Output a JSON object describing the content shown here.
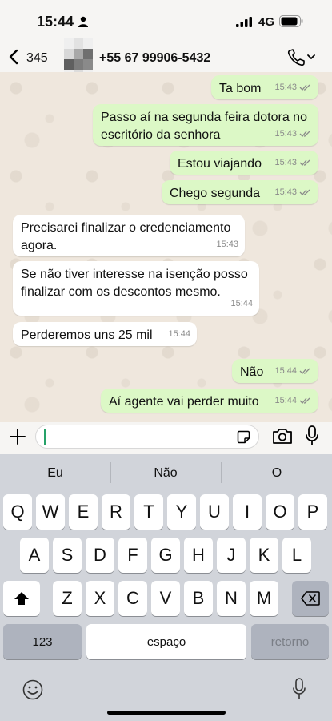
{
  "status_bar": {
    "time": "15:44",
    "network": "4G"
  },
  "header": {
    "back_count": "345",
    "contact": "+55 67 99906-5432"
  },
  "messages": [
    {
      "dir": "out",
      "text": "Ta bom",
      "time": "15:43"
    },
    {
      "dir": "out",
      "text": "Passo aí na segunda feira dotora no\nescritório da senhora",
      "time": "15:43"
    },
    {
      "dir": "out",
      "text": "Estou viajando",
      "time": "15:43"
    },
    {
      "dir": "out",
      "text": "Chego segunda",
      "time": "15:43"
    },
    {
      "dir": "in",
      "text": "Precisarei finalizar o credenciamento\nagora.",
      "time": "15:43"
    },
    {
      "dir": "in",
      "text": "Se não tiver interesse na isenção posso\nfinalizar com os descontos mesmo.",
      "time": "15:44"
    },
    {
      "dir": "in",
      "text": "Perderemos uns 25 mil",
      "time": "15:44"
    },
    {
      "dir": "out",
      "text": "Não",
      "time": "15:44"
    },
    {
      "dir": "out",
      "text": "Aí agente vai perder muito",
      "time": "15:44"
    }
  ],
  "keyboard": {
    "suggestions": [
      "Eu",
      "Não",
      "O"
    ],
    "row1": [
      "Q",
      "W",
      "E",
      "R",
      "T",
      "Y",
      "U",
      "I",
      "O",
      "P"
    ],
    "row2": [
      "A",
      "S",
      "D",
      "F",
      "G",
      "H",
      "J",
      "K",
      "L"
    ],
    "row3": [
      "Z",
      "X",
      "C",
      "V",
      "B",
      "N",
      "M"
    ],
    "numbers_label": "123",
    "space_label": "espaço",
    "return_label": "retorno"
  }
}
